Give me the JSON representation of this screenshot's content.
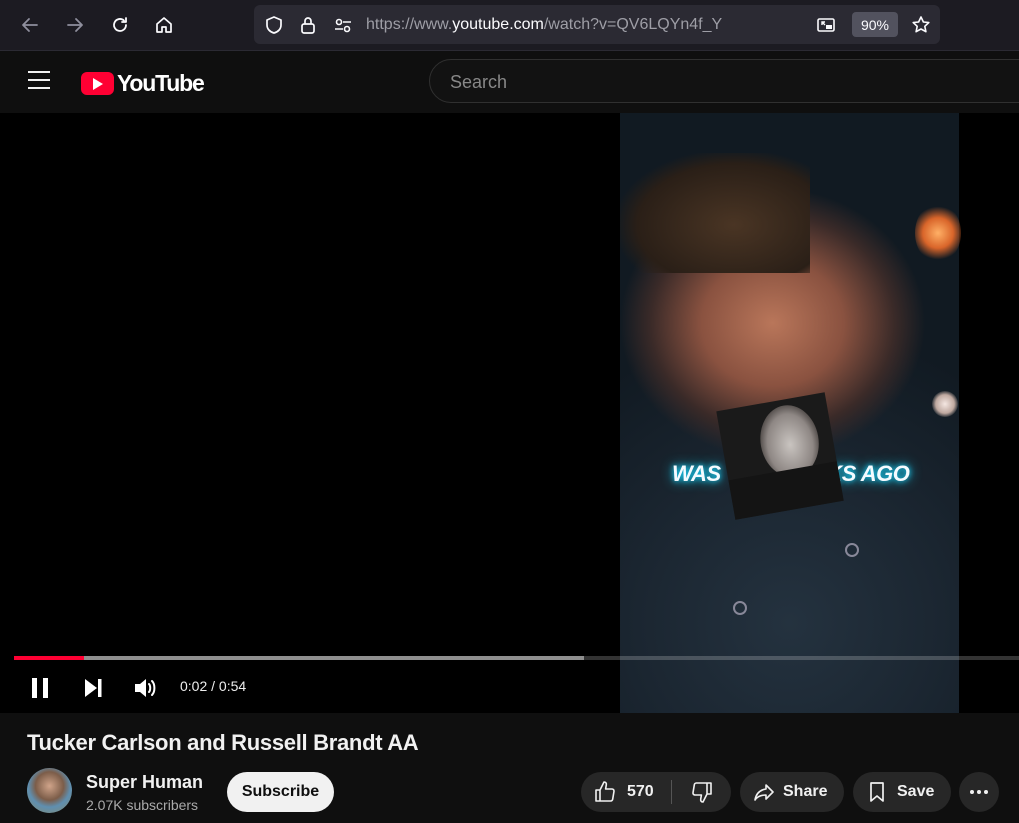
{
  "browser": {
    "url_prefix": "https://www.",
    "url_host": "youtube.com",
    "url_path": "/watch?v=QV6LQYn4f_Y",
    "zoom": "90%",
    "icons": [
      "back-arrow-icon",
      "forward-arrow-icon",
      "reload-icon",
      "home-icon",
      "shield-icon",
      "lock-icon",
      "permissions-icon",
      "picture-in-picture-icon",
      "star-icon"
    ]
  },
  "header": {
    "logo_text": "YouTube",
    "search_placeholder": "Search"
  },
  "player": {
    "caption_left": "WAS",
    "caption_right": "EEKS AGO",
    "current_time": "0:02",
    "duration": "0:54",
    "time_display": "0:02 / 0:54",
    "played_fraction": 0.07,
    "buffered_fraction": 0.567
  },
  "video": {
    "title": "Tucker Carlson and Russell Brandt AA",
    "channel_name": "Super Human",
    "subscribers": "2.07K subscribers",
    "subscribe_label": "Subscribe",
    "like_count": "570",
    "share_label": "Share",
    "save_label": "Save"
  },
  "colors": {
    "accent": "#ff0033",
    "background": "#0f0f0f",
    "button_bg": "#272727",
    "caption_glow": "#19d7ff"
  }
}
